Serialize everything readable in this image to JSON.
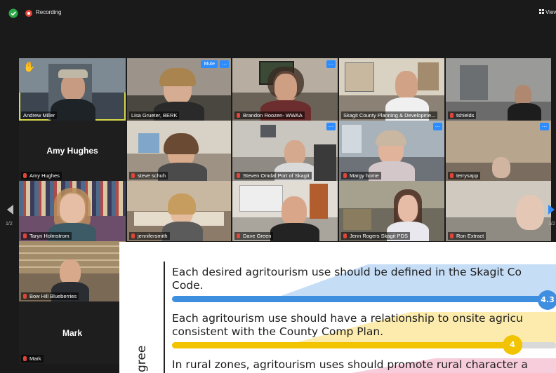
{
  "topbar": {
    "recording_label": "Recording",
    "view_label": "View"
  },
  "navigation": {
    "page_left": "1/2",
    "page_right": "1/2"
  },
  "tiles": {
    "andrew": "Andrew Miller",
    "lisa": "Lisa Grueter, BERK",
    "lisa_mute": "Mute",
    "brandon": "Brandon Roozen- WWAA",
    "skagit": "Skagit County Planning & Developme...",
    "tshields": "tshields",
    "amy_big": "Amy Hughes",
    "amy": "Amy Hughes",
    "steve": "steve schuh",
    "omdal": "Steven Omdal Port of Skagit",
    "margy": "Margy home",
    "terry": "terrysapp",
    "taryn": "Taryn Holmstrom",
    "jennifer": "jennifersmith",
    "dave": "Dave Green",
    "jenn": "Jenn Rogers Skagit PDS",
    "ron": "Ron Extract",
    "bowhill": "Bow Hill Blueberries",
    "mark_big": "Mark",
    "mark": "Mark"
  },
  "slide": {
    "axis_label": "gree",
    "statements": [
      {
        "line1": "Each desired agritourism use should be defined in the Skagit Co",
        "line2": "Code.",
        "score": "4.3"
      },
      {
        "line1": "Each agritourism use should have a relationship to onsite agricu",
        "line2": "consistent with the County Comp Plan.",
        "score": "4"
      },
      {
        "line1": "In rural zones, agritourism uses should promote rural character a",
        "line2": "",
        "score": ""
      }
    ]
  },
  "colors": {
    "accent": "#2d8cff",
    "speaker_border": "#d8d84a",
    "muted_icon": "#e0453a",
    "bar_blue": "#3f8fe0",
    "bar_yellow": "#f2c300",
    "band_blue": "#bfd9f5",
    "band_yellow": "#fbe9a3",
    "band_pink": "#f6c6d7"
  }
}
